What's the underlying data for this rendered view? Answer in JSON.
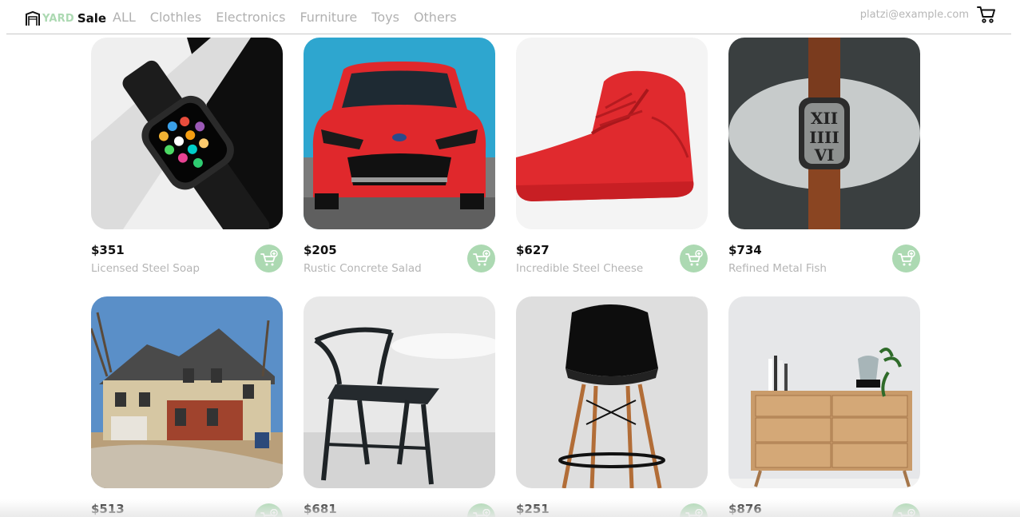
{
  "header": {
    "logo_yard": "YARD",
    "logo_sale": "Sale",
    "nav": [
      "ALL",
      "Clothles",
      "Electronics",
      "Furniture",
      "Toys",
      "Others"
    ],
    "email": "platzi@example.com",
    "cart_icon": "shopping-cart-icon"
  },
  "theme": {
    "accent": "#acd9b2",
    "text_muted": "#b1b1b1"
  },
  "products": [
    {
      "price": "$351",
      "name": "Licensed Steel Soap",
      "image": "smartwatch-photo"
    },
    {
      "price": "$205",
      "name": "Rustic Concrete Salad",
      "image": "red-car-photo"
    },
    {
      "price": "$627",
      "name": "Incredible Steel Cheese",
      "image": "red-sneaker-photo"
    },
    {
      "price": "$734",
      "name": "Refined Metal Fish",
      "image": "wristwatch-photo"
    },
    {
      "price": "$513",
      "name": "",
      "image": "house-photo"
    },
    {
      "price": "$681",
      "name": "",
      "image": "black-chair-photo"
    },
    {
      "price": "$251",
      "name": "",
      "image": "bar-stool-photo"
    },
    {
      "price": "$876",
      "name": "",
      "image": "wooden-dresser-photo"
    }
  ],
  "add_to_cart_icon": "add-to-cart-icon"
}
